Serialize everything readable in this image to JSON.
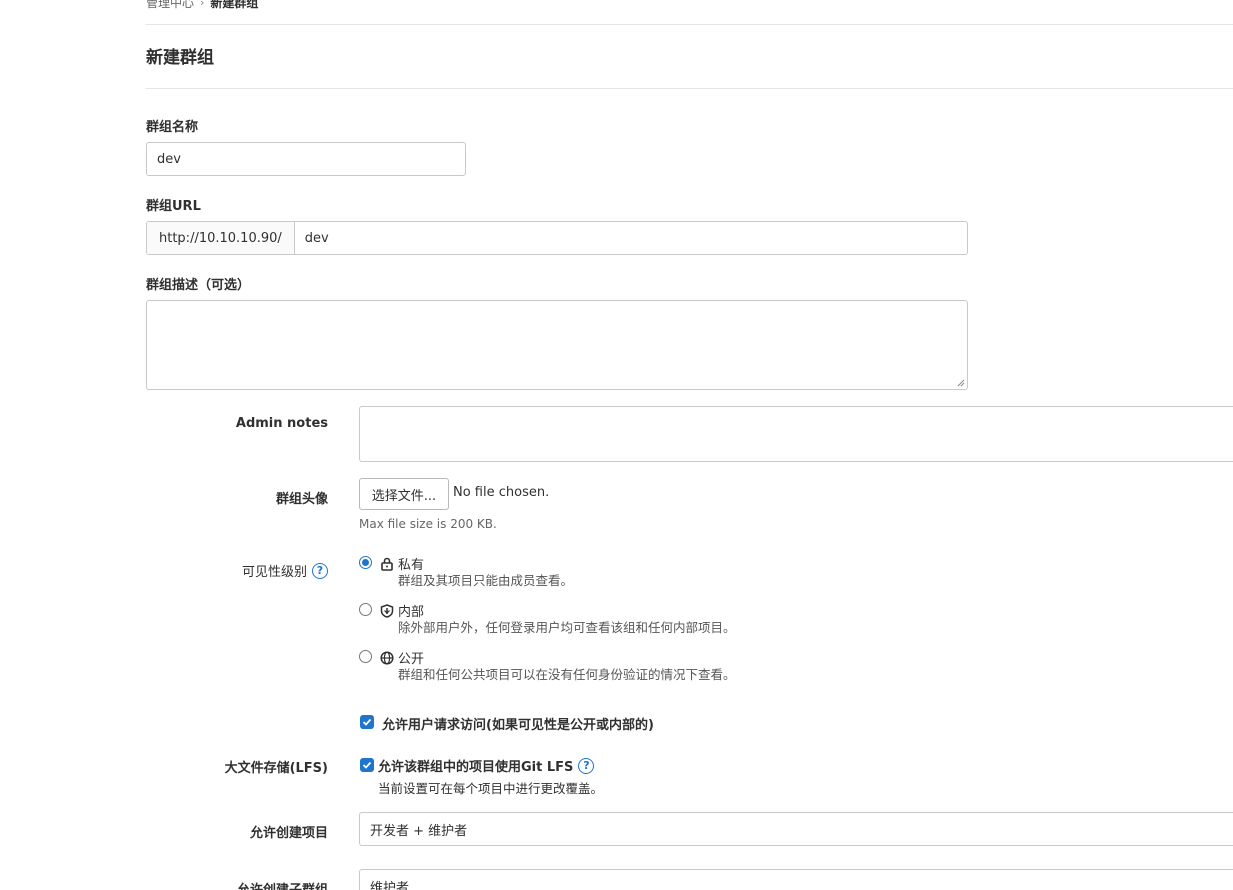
{
  "breadcrumb": {
    "parent": "管理中心",
    "separator": "›",
    "current": "新建群组"
  },
  "page_title": "新建群组",
  "group_name": {
    "label": "群组名称",
    "value": "dev"
  },
  "group_url": {
    "label": "群组URL",
    "prefix": "http://10.10.10.90/",
    "path": "dev"
  },
  "group_description": {
    "label": "群组描述（可选）",
    "value": ""
  },
  "admin_notes": {
    "label": "Admin notes",
    "value": ""
  },
  "avatar": {
    "label": "群组头像",
    "button": "选择文件...",
    "status": "No file chosen.",
    "hint": "Max file size is 200 KB."
  },
  "visibility": {
    "label": "可见性级别",
    "help_icon": "?",
    "selected": "private",
    "options": [
      {
        "title": "私有",
        "icon": "lock-icon",
        "desc": "群组及其项目只能由成员查看。"
      },
      {
        "title": "内部",
        "icon": "shield-icon",
        "desc": "除外部用户外，任何登录用户均可查看该组和任何内部项目。"
      },
      {
        "title": "公开",
        "icon": "globe-icon",
        "desc": "群组和任何公共项目可以在没有任何身份验证的情况下查看。"
      }
    ]
  },
  "request_access": {
    "label": "允许用户请求访问(如果可见性是公开或内部的)",
    "checked": true
  },
  "lfs": {
    "label": "大文件存储(LFS)",
    "checkbox_label": "允许该群组中的项目使用Git LFS",
    "help_icon": "?",
    "hint": "当前设置可在每个项目中进行更改覆盖。",
    "checked": true
  },
  "project_creation": {
    "label": "允许创建项目",
    "value": "开发者 + 维护者"
  },
  "subgroup_creation": {
    "label": "允许创建子群组",
    "value": "维护者"
  },
  "colors": {
    "accent": "#1f75cb",
    "border": "#c9c9c9",
    "text": "#303030"
  }
}
